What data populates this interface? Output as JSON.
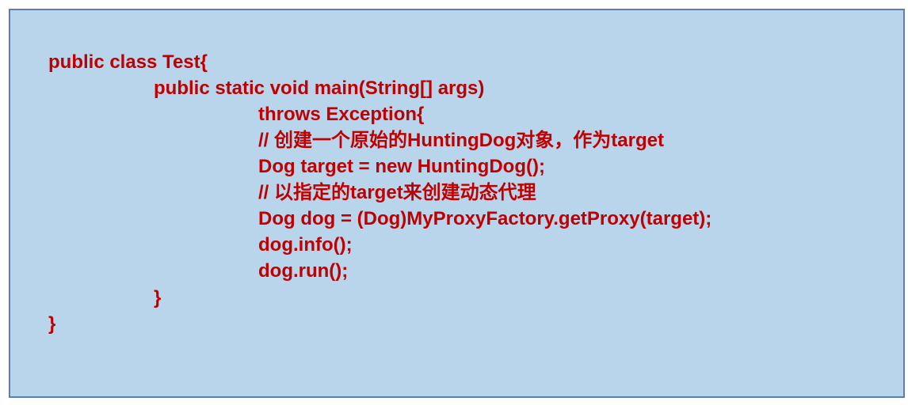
{
  "code_block": {
    "lines": [
      "public class Test{",
      "public static void main(String[] args)",
      "throws Exception{",
      "// 创建一个原始的HuntingDog对象，作为target",
      "Dog target = new HuntingDog();",
      "// 以指定的target来创建动态代理",
      "Dog dog = (Dog)MyProxyFactory.getProxy(target);",
      "dog.info();",
      "dog.run();",
      "}",
      "}"
    ]
  },
  "colors": {
    "panel_background": "#b9d5ec",
    "panel_border": "#5b7fae",
    "code_text": "#c00000"
  }
}
